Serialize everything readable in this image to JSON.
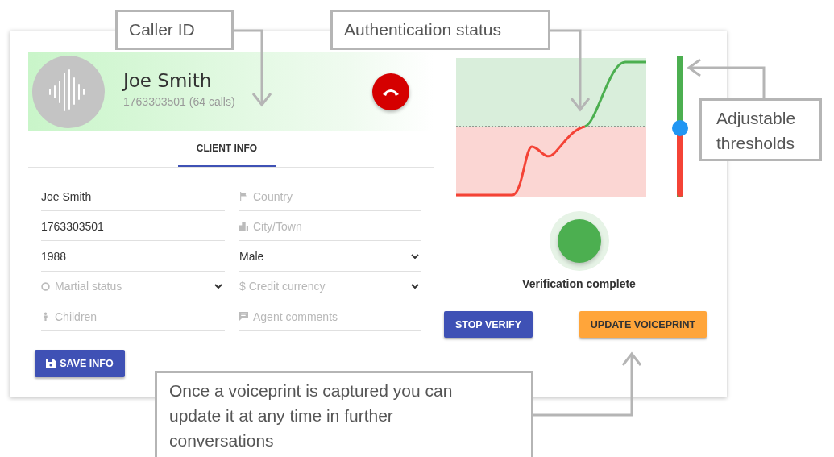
{
  "caller": {
    "name": "Joe Smith",
    "detail": "1763303501 (64 calls)"
  },
  "tabs": [
    {
      "label": "CLIENT INFO",
      "selected": true
    }
  ],
  "fields": [
    {
      "kind": "text",
      "value": "Joe Smith"
    },
    {
      "kind": "text",
      "placeholder": "Country"
    },
    {
      "kind": "text",
      "value": "1763303501"
    },
    {
      "kind": "text",
      "placeholder": "City/Town"
    },
    {
      "kind": "text",
      "value": "1988"
    },
    {
      "kind": "select",
      "value": "Male"
    },
    {
      "kind": "select",
      "placeholder": "Martial status"
    },
    {
      "kind": "select",
      "placeholder": "$ Credit currency"
    },
    {
      "kind": "text",
      "placeholder": "Children"
    },
    {
      "kind": "text",
      "placeholder": "Agent comments"
    }
  ],
  "save_button": "SAVE INFO",
  "threshold": {
    "level": 0.49
  },
  "verification": {
    "verified": true,
    "label": "Verification complete"
  },
  "buttons": [
    {
      "label": "STOP VERIFY",
      "kind": "primary"
    },
    {
      "label": "UPDATE VOICEPRINT",
      "kind": "accent"
    }
  ],
  "callouts": [
    {
      "text": "Caller ID"
    },
    {
      "text": "Authentication status"
    },
    {
      "text": "Adjustable thresholds"
    },
    {
      "text": "Once a voiceprint is captured you can update it at any time in further conversations"
    }
  ]
}
